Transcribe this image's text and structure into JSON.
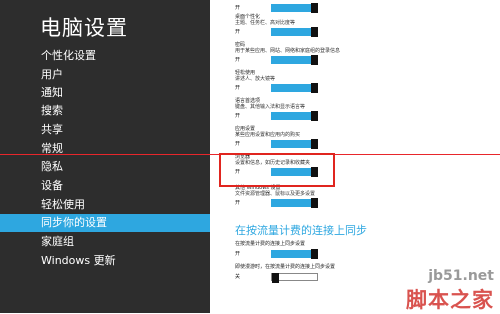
{
  "left": {
    "title": "电脑设置",
    "nav": [
      {
        "label": "个性化设置",
        "name": "personalize"
      },
      {
        "label": "用户",
        "name": "users"
      },
      {
        "label": "通知",
        "name": "notifications"
      },
      {
        "label": "搜索",
        "name": "search"
      },
      {
        "label": "共享",
        "name": "share"
      },
      {
        "label": "常规",
        "name": "general"
      },
      {
        "label": "隐私",
        "name": "privacy"
      },
      {
        "label": "设备",
        "name": "devices"
      },
      {
        "label": "轻松使用",
        "name": "ease-of-access"
      },
      {
        "label": "同步你的设置",
        "name": "sync-settings",
        "active": true
      },
      {
        "label": "家庭组",
        "name": "homegroup"
      },
      {
        "label": "Windows 更新",
        "name": "windows-update"
      }
    ]
  },
  "right": {
    "settings": [
      {
        "title": "",
        "desc": "",
        "state": "开",
        "on": true
      },
      {
        "title": "桌面个性化",
        "desc": "主题、任务栏、高对比度等",
        "state": "开",
        "on": true
      },
      {
        "title": "密码",
        "desc": "用于某些应用、网站、网络和家庭组的登录信息",
        "state": "开",
        "on": true
      },
      {
        "title": "轻松使用",
        "desc": "讲述人、放大镜等",
        "state": "开",
        "on": true
      },
      {
        "title": "语言首选项",
        "desc": "键盘、其他输入法和显示语言等",
        "state": "开",
        "on": true
      },
      {
        "title": "应用设置",
        "desc": "某些应用设置和应用内的购买",
        "state": "开",
        "on": true
      },
      {
        "title": "浏览器",
        "desc": "设置和信息，如历史记录和收藏夹",
        "state": "开",
        "on": true
      },
      {
        "title": "其他 Windows 设置",
        "desc": "文件资源管理器、鼠标以及更多设置",
        "state": "开",
        "on": true
      }
    ],
    "metered_heading": "在按流量计费的连接上同步",
    "metered": [
      {
        "title": "在按流量计费的连接上同步设置",
        "desc": "",
        "state": "开",
        "on": true
      },
      {
        "title": "即使漫游时，在按流量计费的连接上同步设置",
        "desc": "",
        "state": "关",
        "on": false
      }
    ]
  },
  "watermark": {
    "top": "jb51.net",
    "bottom": "脚本之家"
  },
  "colors": {
    "accent": "#2ea7e0",
    "highlight": "#e0251f",
    "sidebar": "#2d2d2d"
  }
}
